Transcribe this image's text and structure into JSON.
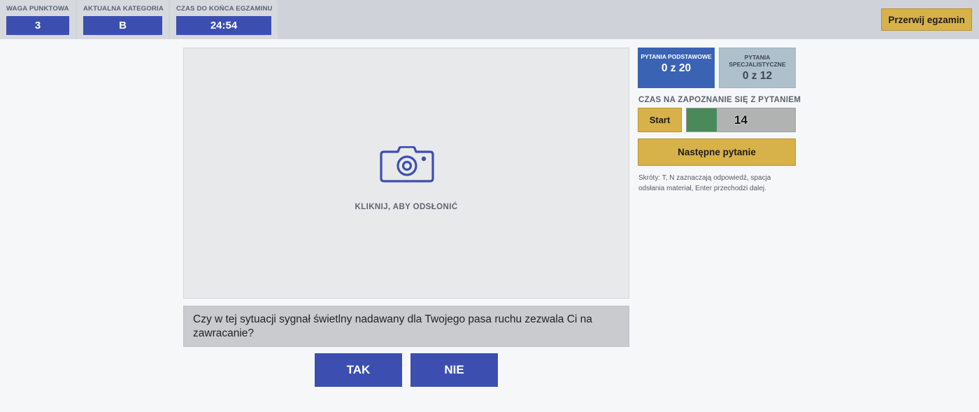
{
  "topbar": {
    "waga_label": "WAGA PUNKTOWA",
    "waga_value": "3",
    "kategoria_label": "AKTUALNA KATEGORIA",
    "kategoria_value": "B",
    "czas_label": "CZAS DO KOŃCA EGZAMINU",
    "czas_value": "24:54",
    "abort_label": "Przerwij egzamin"
  },
  "media": {
    "icon": "camera-icon",
    "reveal_text": "KLIKNIJ, ABY ODSŁONIĆ"
  },
  "question": {
    "text": "Czy w tej sytuacji sygnał świetlny nadawany dla Twojego pasa ruchu zezwala Ci na zawracanie?",
    "yes_label": "TAK",
    "no_label": "NIE"
  },
  "panel": {
    "basic_label": "PYTANIA PODSTAWOWE",
    "basic_value": "0 z 20",
    "spec_label": "PYTANIA SPECJALISTYCZNE",
    "spec_value": "0 z 12",
    "timer_label": "CZAS NA ZAPOZNANIE SIĘ Z PYTANIEM",
    "start_label": "Start",
    "timer_value": "14",
    "timer_fill_fraction": 0.28,
    "next_label": "Następne pytanie",
    "shortcuts_text": "Skróty: T, N zaznaczają odpowiedź, spacja odsłania materiał, Enter przechodzi dalej."
  },
  "colors": {
    "primary": "#3c4fb1",
    "accent": "#d7b24a",
    "timer_green": "#4a8a5a"
  }
}
